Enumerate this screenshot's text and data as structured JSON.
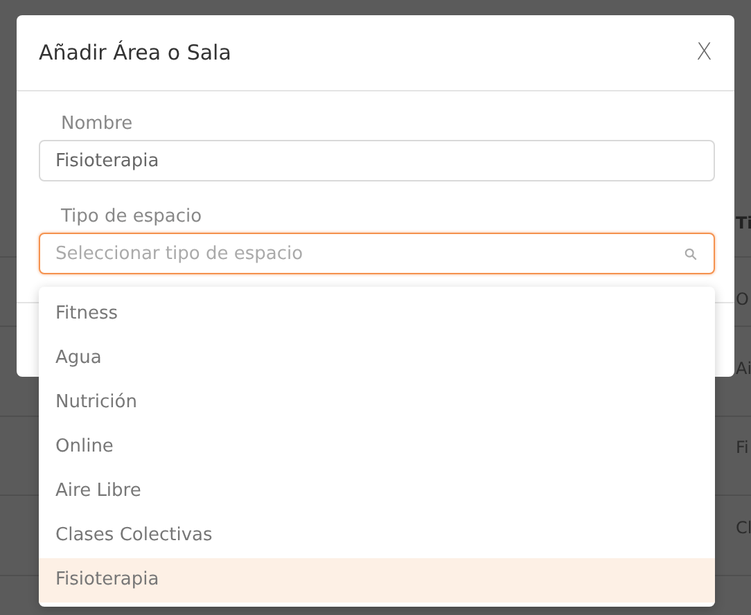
{
  "background": {
    "cells": [
      {
        "text": "Ti",
        "kind": "heading"
      },
      {
        "text": "O",
        "kind": "cell"
      },
      {
        "text": "Ai",
        "kind": "cell"
      },
      {
        "text": "Fi",
        "kind": "cell"
      },
      {
        "text": "Cl",
        "kind": "cell"
      }
    ]
  },
  "dialog": {
    "title": "Añadir Área o Sala",
    "close": "X",
    "fields": [
      {
        "label": "Nombre",
        "value": "Fisioterapia"
      },
      {
        "label": "Tipo de espacio",
        "placeholder": "Seleccionar tipo de espacio",
        "focused": true
      }
    ],
    "options": [
      {
        "label": "Fitness",
        "selected": false
      },
      {
        "label": "Agua",
        "selected": false
      },
      {
        "label": "Nutrición",
        "selected": false
      },
      {
        "label": "Online",
        "selected": false
      },
      {
        "label": "Aire Libre",
        "selected": false
      },
      {
        "label": "Clases Colectivas",
        "selected": false
      },
      {
        "label": "Fisioterapia",
        "selected": true
      }
    ]
  }
}
